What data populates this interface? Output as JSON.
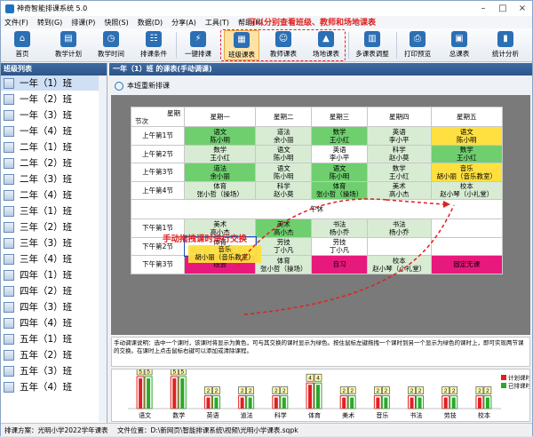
{
  "window": {
    "title": "神奇智能排课系统 5.0"
  },
  "menu": [
    "文件(F)",
    "转到(G)",
    "排课(P)",
    "快照(S)",
    "数据(D)",
    "分享(A)",
    "工具(T)",
    "帮助(H)"
  ],
  "callout": "可以分别查看班级、教师和场地课表",
  "toolbar": [
    "首页",
    "教学计划",
    "教学时间",
    "排课条件",
    "一键排课",
    "班级课表",
    "教师课表",
    "场地课表",
    "多课表调整",
    "打印预览",
    "总课表",
    "统计分析"
  ],
  "sidebar": {
    "header": "班级列表",
    "classes": [
      "一年（1）班",
      "一年（2）班",
      "一年（3）班",
      "一年（4）班",
      "二年（1）班",
      "二年（2）班",
      "二年（3）班",
      "二年（4）班",
      "三年（1）班",
      "三年（2）班",
      "三年（3）班",
      "三年（4）班",
      "四年（1）班",
      "四年（2）班",
      "四年（3）班",
      "四年（4）班",
      "五年（1）班",
      "五年（2）班",
      "五年（3）班",
      "五年（4）班"
    ]
  },
  "main": {
    "header": "一年（1）班 的课表(手动调课)",
    "new_schedule": "本班重新排课"
  },
  "schedule": {
    "corner_top": "星期",
    "corner_bottom": "节次",
    "days": [
      "星期一",
      "星期二",
      "星期三",
      "星期四",
      "星期五"
    ],
    "noon": "午休",
    "rows": [
      {
        "label": "上午第1节",
        "cells": [
          [
            "",
            ""
          ],
          [
            "语文",
            "陈小明"
          ],
          [
            "道法",
            "余小丽"
          ],
          [
            "数学",
            "王小红"
          ],
          [
            "英语",
            "李小平"
          ],
          [
            "语文",
            "陈小明"
          ]
        ]
      },
      {
        "label": "上午第2节",
        "cells": [
          [
            "",
            ""
          ],
          [
            "数学",
            "王小红"
          ],
          [
            "语文",
            "陈小明"
          ],
          [
            "英语",
            "李小平"
          ],
          [
            "科学",
            "赵小莫"
          ],
          [
            "数学",
            "王小红"
          ]
        ]
      },
      {
        "label": "上午第3节",
        "cells": [
          [
            "",
            ""
          ],
          [
            "道法",
            "余小丽"
          ],
          [
            "语文",
            "陈小明"
          ],
          [
            "语文",
            "陈小明"
          ],
          [
            "数学",
            "王小红"
          ],
          [
            "音乐",
            "胡小丽（音乐教室）"
          ]
        ]
      },
      {
        "label": "上午第4节",
        "cells": [
          [
            "",
            ""
          ],
          [
            "体育",
            "张小哲（操场）"
          ],
          [
            "科学",
            "赵小莫"
          ],
          [
            "体育",
            "张小哲（操场）"
          ],
          [
            "美术",
            "高小杰"
          ],
          [
            "校本",
            "赵小琴（小礼堂）"
          ]
        ]
      },
      {
        "label": "下午第1节",
        "cells": [
          [
            "",
            ""
          ],
          [
            "美术",
            "高小杰"
          ],
          [
            "美术",
            "高小杰"
          ],
          [
            "书法",
            "杨小乔"
          ],
          [
            "书法",
            "杨小乔"
          ],
          [
            "",
            ""
          ]
        ]
      },
      {
        "label": "下午第2节",
        "cells": [
          [
            "",
            ""
          ],
          [
            "体育",
            "胡小丽（音乐教室）"
          ],
          [
            "劳技",
            "丁小凡"
          ],
          [
            "劳技",
            "丁小凡"
          ],
          [
            "",
            ""
          ],
          [
            "",
            ""
          ]
        ]
      },
      {
        "label": "下午第3节",
        "cells": [
          [
            "",
            ""
          ],
          [
            "班会",
            ""
          ],
          [
            "体育",
            "张小哲（操场）"
          ],
          [
            "自习",
            ""
          ],
          [
            "校本",
            "赵小琴（小礼堂）"
          ],
          [
            "固定无课",
            ""
          ]
        ]
      }
    ],
    "drag_overlay": {
      "subject": "音乐",
      "teacher": "胡小丽（音乐教室）"
    },
    "drag_hint": "手动拖拽课时进行交换"
  },
  "instructions": "手动调课说明：选中一个课时，该课时将显示为黄色，可与其交换的课时显示为绿色。按住鼠标左键拖拽一个课时到另一个显示为绿色的课时上，即可实现两节课的交换。在课时上点击鼠标右键可以添加或清除课程。",
  "chart_data": {
    "type": "bar",
    "categories": [
      "语文",
      "数学",
      "英语",
      "道法",
      "科学",
      "体育",
      "美术",
      "音乐",
      "书法",
      "劳技",
      "校本"
    ],
    "series": [
      {
        "name": "计划课时",
        "values": [
          5,
          5,
          2,
          2,
          2,
          4,
          2,
          2,
          2,
          2,
          2
        ]
      },
      {
        "name": "已排课时",
        "values": [
          5,
          5,
          2,
          2,
          2,
          4,
          2,
          2,
          2,
          2,
          2
        ]
      }
    ],
    "colors": {
      "计划课时": "#e02020",
      "已排课时": "#2aa82a"
    }
  },
  "status": {
    "scheme": "排课方案：光明小学2022学年课表",
    "file": "文件位置：D:\\新网页\\智能排课系统\\视频\\光明小学课表.sqpk"
  }
}
